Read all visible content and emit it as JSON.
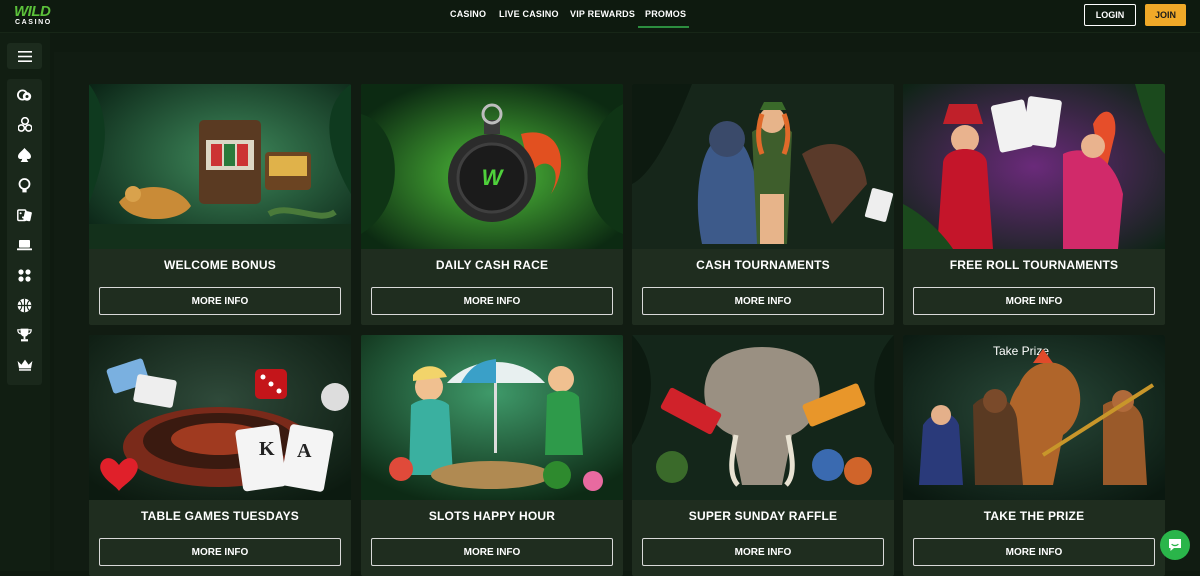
{
  "logo": {
    "line1": "WILD",
    "line2": "CASINO"
  },
  "nav": {
    "items": [
      {
        "label": "CASINO",
        "active": false
      },
      {
        "label": "LIVE CASINO",
        "active": false
      },
      {
        "label": "VIP REWARDS",
        "active": false
      },
      {
        "label": "PROMOS",
        "active": true
      }
    ]
  },
  "auth": {
    "login_label": "LOGIN",
    "join_label": "JOIN"
  },
  "sidebar": {
    "menu_icon": "hamburger-icon",
    "icons": [
      "chips-icon",
      "tree-icon",
      "spade-icon",
      "helmet-icon",
      "dice-icon",
      "laptop-icon",
      "grid-icon",
      "basketball-icon",
      "trophy-icon",
      "crown-icon"
    ]
  },
  "promos": [
    {
      "title": "WELCOME BONUS",
      "button": "MORE INFO"
    },
    {
      "title": "DAILY CASH RACE",
      "button": "MORE INFO"
    },
    {
      "title": "CASH TOURNAMENTS",
      "button": "MORE INFO"
    },
    {
      "title": "FREE ROLL TOURNAMENTS",
      "button": "MORE INFO"
    },
    {
      "title": "TABLE GAMES TUESDAYS",
      "button": "MORE INFO"
    },
    {
      "title": "SLOTS HAPPY HOUR",
      "button": "MORE INFO"
    },
    {
      "title": "SUPER SUNDAY RAFFLE",
      "button": "MORE INFO"
    },
    {
      "title": "TAKE THE PRIZE",
      "button": "MORE INFO"
    }
  ],
  "art_text": {
    "take_prize": "Take Prize"
  },
  "colors": {
    "accent": "#f0a928",
    "brand": "#5bc13a",
    "chat": "#2ab54a"
  },
  "chat_icon": "chat-bubble-icon"
}
